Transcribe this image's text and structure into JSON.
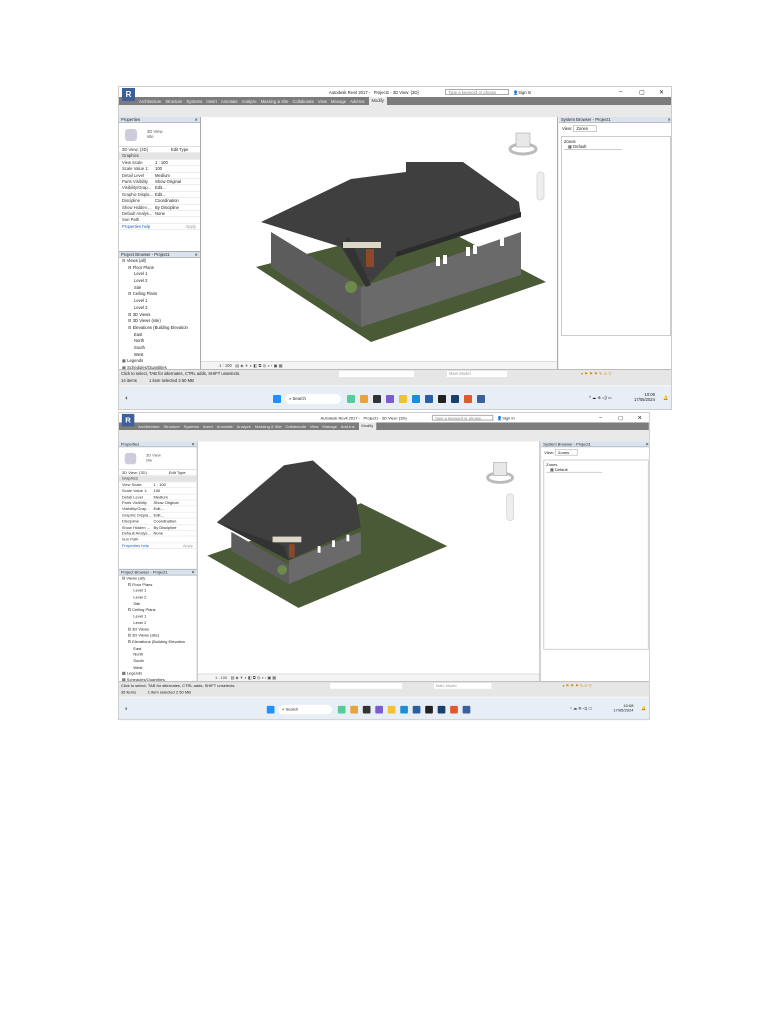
{
  "screens": [
    {
      "app_title": "Autodesk Revit 2017 -",
      "project_title": "Project1 - 3D View: {3D}",
      "search_placeholder": "Type a keyword or phrase",
      "sign_in": "Sign In",
      "ribbon_tabs": [
        "Architecture",
        "Structure",
        "Systems",
        "Insert",
        "Annotate",
        "Analyze",
        "Massing & Site",
        "Collaborate",
        "View",
        "Manage",
        "Add-Ins",
        "Modify"
      ],
      "active_tab": "Modify",
      "properties": {
        "title": "Properties",
        "type_name": "3D View",
        "type_sub": "site",
        "selector": "3D View: {3D}",
        "edit_type": "Edit Type",
        "group": "Graphics",
        "rows": [
          {
            "k": "View Scale",
            "v": "1 : 100"
          },
          {
            "k": "Scale Value 1:",
            "v": "100"
          },
          {
            "k": "Detail Level",
            "v": "Medium"
          },
          {
            "k": "Parts Visibility",
            "v": "Show Original"
          },
          {
            "k": "Visibility/Grap...",
            "v": "Edit..."
          },
          {
            "k": "Graphic Displa...",
            "v": "Edit..."
          },
          {
            "k": "Discipline",
            "v": "Coordination"
          },
          {
            "k": "Show Hidden ...",
            "v": "By Discipline"
          },
          {
            "k": "Default Analys...",
            "v": "None"
          },
          {
            "k": "Sun Path",
            "v": ""
          }
        ],
        "help": "Properties help",
        "apply": "Apply"
      },
      "project_browser": {
        "title": "Project Browser - Project1",
        "items": [
          "Views (all)",
          "Floor Plans",
          "Level 1",
          "Level 2",
          "Site",
          "Ceiling Plans",
          "Level 1",
          "Level 2",
          "3D Views",
          "3D Views (site)",
          "Elevations (Building Elevation",
          "East",
          "North",
          "South",
          "West",
          "Legends",
          "Schedules/Quantities"
        ]
      },
      "view_scale": "1 : 100",
      "system_browser": {
        "title": "System Browser - Project1",
        "view_label": "View:",
        "view_value": "Zones",
        "root": "Zones",
        "child": "Default"
      },
      "status_text": "Click to select, TAB for alternates, CTRL adds, SHIFT unselects.",
      "items_count": "14 items",
      "selected": "1 item selected  2.50 MB",
      "model": "Main Model",
      "taskbar_search": "Search",
      "time": "10:06",
      "date": "17/05/2024"
    },
    {
      "app_title": "Autodesk Revit 2017 -",
      "project_title": "Project1 - 3D View: {3D}",
      "search_placeholder": "Type a keyword or phrase",
      "sign_in": "Sign In",
      "ribbon_tabs": [
        "Architecture",
        "Structure",
        "Systems",
        "Insert",
        "Annotate",
        "Analyze",
        "Massing & Site",
        "Collaborate",
        "View",
        "Manage",
        "Add-Ins",
        "Modify"
      ],
      "active_tab": "Modify",
      "properties": {
        "title": "Properties",
        "type_name": "3D View",
        "type_sub": "site",
        "selector": "3D View: {3D}",
        "edit_type": "Edit Type",
        "group": "Graphics",
        "rows": [
          {
            "k": "View Scale",
            "v": "1 : 100"
          },
          {
            "k": "Scale Value 1:",
            "v": "100"
          },
          {
            "k": "Detail Level",
            "v": "Medium"
          },
          {
            "k": "Parts Visibility",
            "v": "Show Original"
          },
          {
            "k": "Visibility/Grap...",
            "v": "Edit..."
          },
          {
            "k": "Graphic Displa...",
            "v": "Edit..."
          },
          {
            "k": "Discipline",
            "v": "Coordination"
          },
          {
            "k": "Show Hidden ...",
            "v": "By Discipline"
          },
          {
            "k": "Default Analys...",
            "v": "None"
          },
          {
            "k": "Sun Path",
            "v": ""
          }
        ],
        "help": "Properties help",
        "apply": "Apply"
      },
      "project_browser": {
        "title": "Project Browser - Project1",
        "items": [
          "Views (all)",
          "Floor Plans",
          "Level 1",
          "Level 2",
          "Site",
          "Ceiling Plans",
          "Level 1",
          "Level 2",
          "3D Views",
          "3D Views (site)",
          "Elevations (Building Elevation",
          "East",
          "North",
          "South",
          "West",
          "Legends",
          "Schedules/Quantities"
        ]
      },
      "view_scale": "1 : 100",
      "system_browser": {
        "title": "System Browser - Project1",
        "view_label": "View:",
        "view_value": "Zones",
        "root": "Zones",
        "child": "Default"
      },
      "status_text": "Click to select, TAB for alternates, CTRL adds, SHIFT unselects.",
      "items_count": "35 items",
      "selected": "1 item selected  2.50 MB",
      "model": "Main Model",
      "taskbar_search": "Search",
      "time": "10:08",
      "date": "17/05/2024"
    }
  ]
}
